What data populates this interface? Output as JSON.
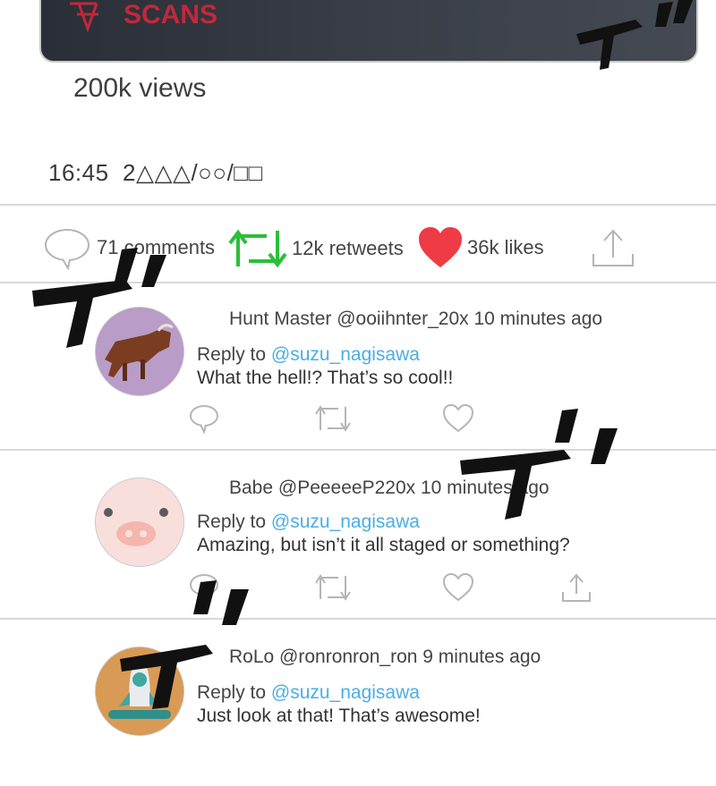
{
  "post": {
    "logo_text": "SCANS",
    "views": "200k views",
    "timestamp": "16:45  2△△△/○○/□□"
  },
  "stats": {
    "comments": "71 comments",
    "retweets": "12k retweets",
    "likes": "36k likes",
    "icons": [
      "comment-icon",
      "retweet-icon",
      "heart-icon",
      "share-icon"
    ],
    "colors": {
      "retweet": "#2bbf3a",
      "like": "#ee3b45"
    }
  },
  "replies": [
    {
      "meta": "Hunt Master @ooiihnter_20x 10 minutes ago",
      "reply_prefix": "Reply to ",
      "reply_handle": "@suzu_nagisawa",
      "text": "What the hell!? That’s so cool!!",
      "avatar": "bull-avatar"
    },
    {
      "meta": "Babe @PeeeeeP220x 10 minutes ago",
      "reply_prefix": "Reply to ",
      "reply_handle": "@suzu_nagisawa",
      "text": "Amazing, but isn’t it all staged or something?",
      "avatar": "pig-avatar"
    },
    {
      "meta": "RoLo @ronronron_ron 9 minutes ago",
      "reply_prefix": "Reply to ",
      "reply_handle": "@suzu_nagisawa",
      "text": "Just look at that! That’s awesome!",
      "avatar": "rocket-avatar"
    }
  ],
  "colors": {
    "mention": "#4aaee6",
    "divider": "#d8d8d8",
    "icon_gray": "#b5b5b5"
  }
}
